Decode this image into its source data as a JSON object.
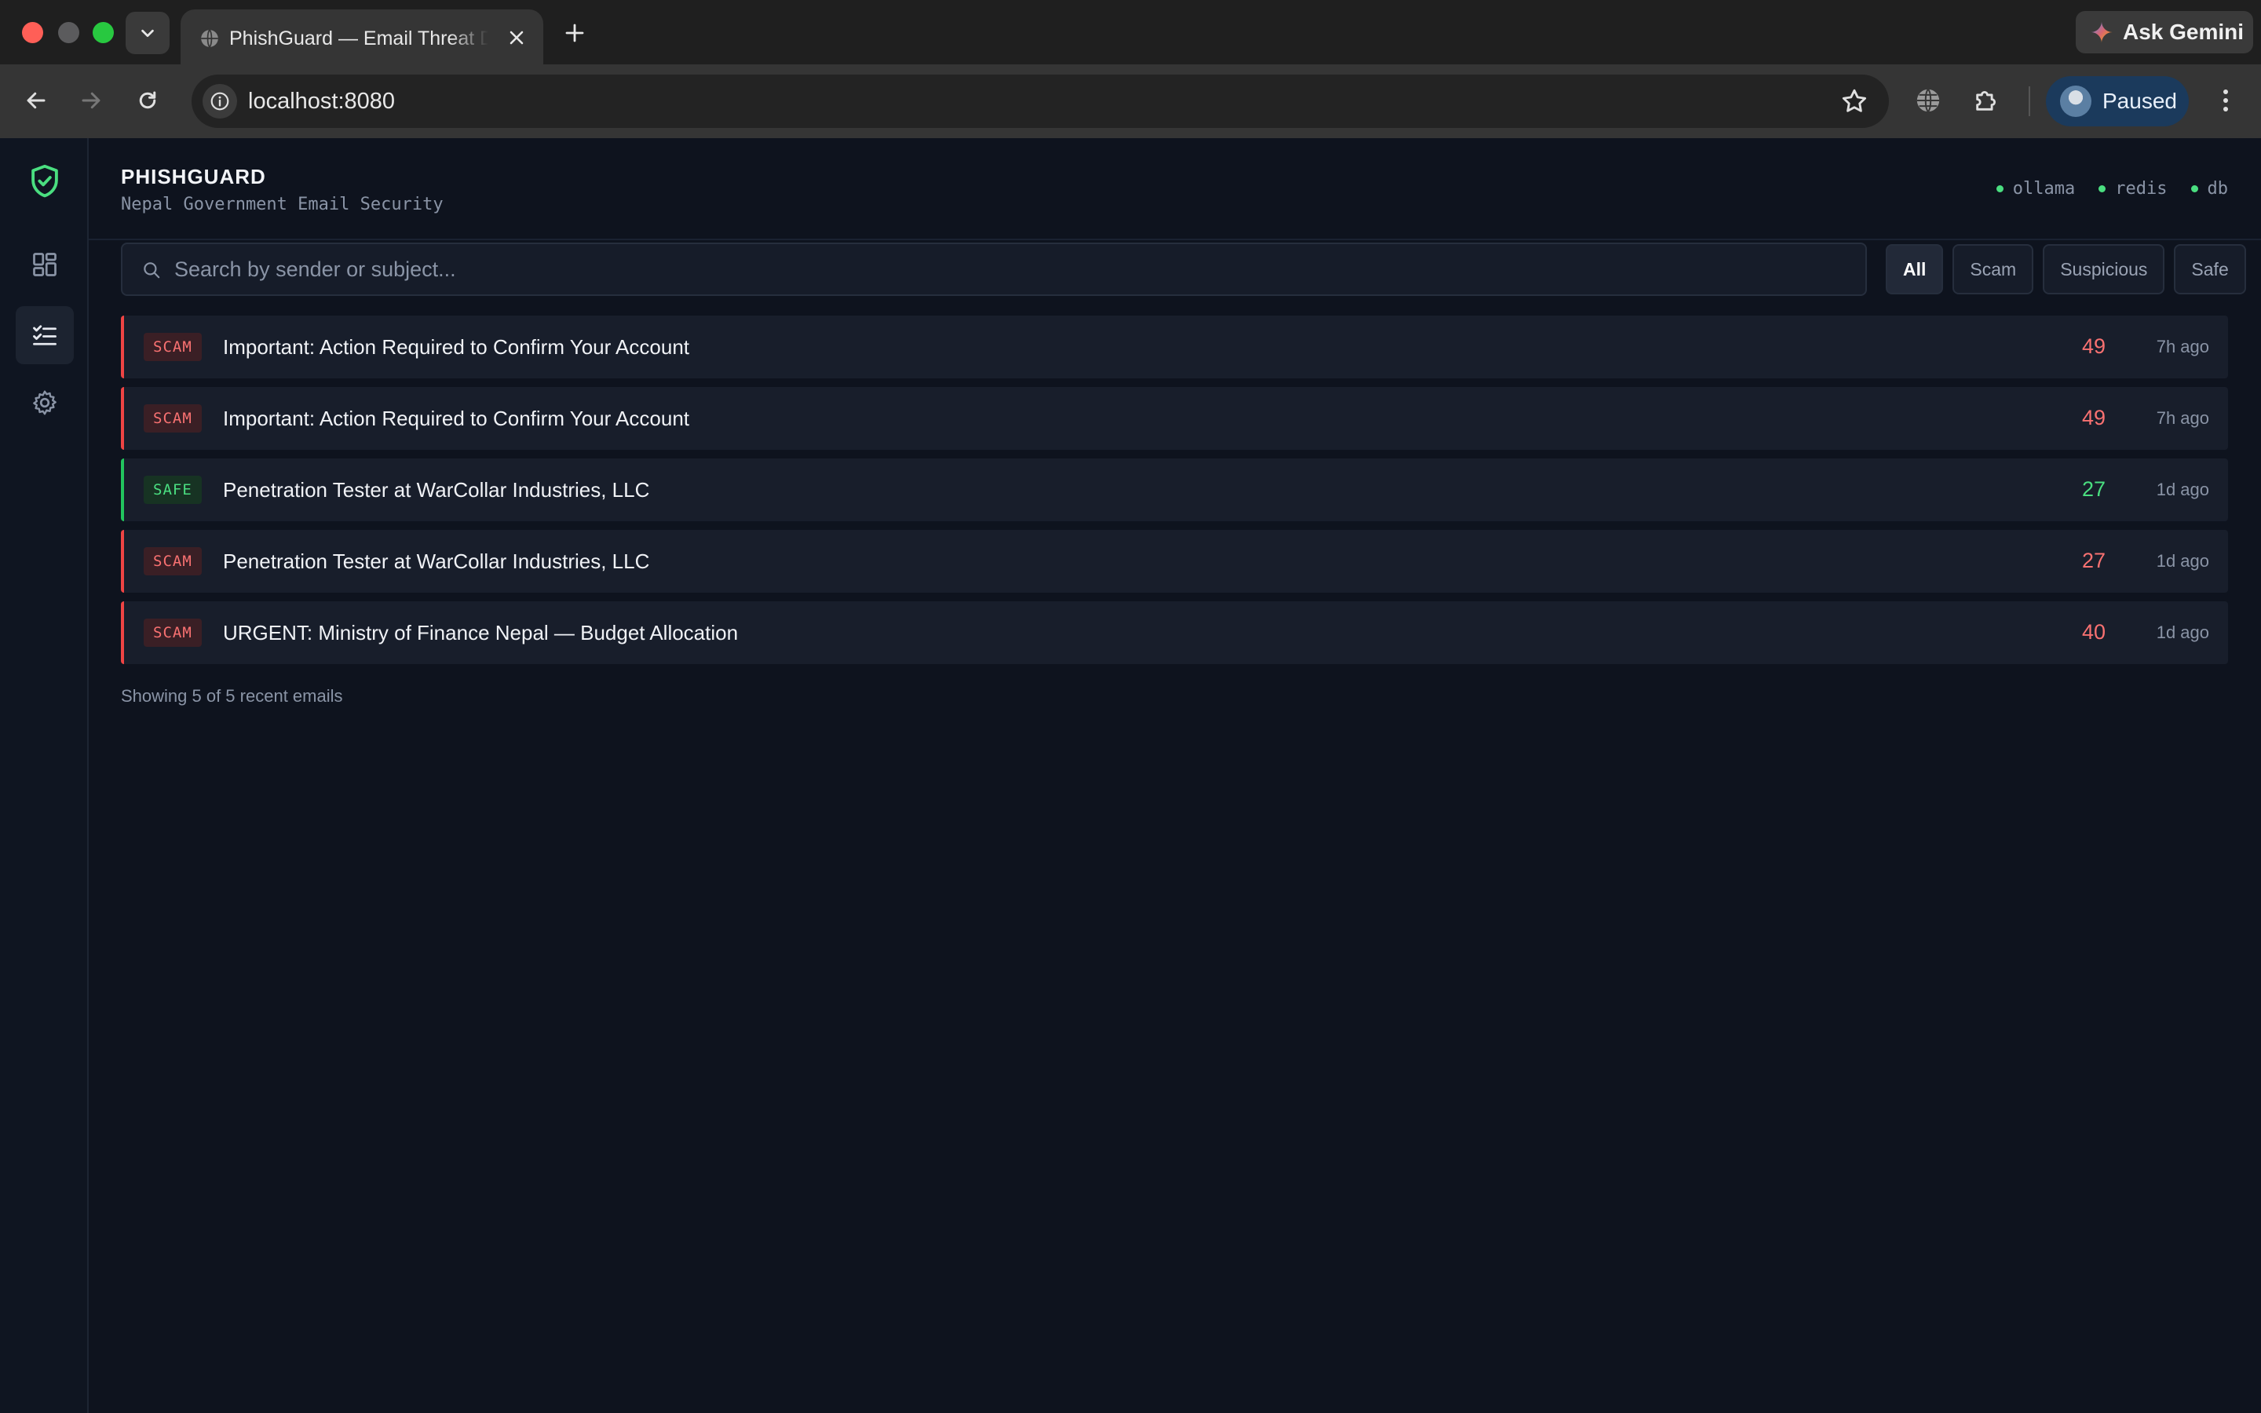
{
  "browser": {
    "tab_title": "PhishGuard — Email Threat Dashboard",
    "url": "localhost:8080",
    "gemini_label": "Ask Gemini",
    "profile_status": "Paused"
  },
  "app": {
    "brand": "PHISHGUARD",
    "subtitle": "Nepal Government Email Security",
    "services": [
      {
        "name": "ollama",
        "status_color": "#4ade80"
      },
      {
        "name": "redis",
        "status_color": "#4ade80"
      },
      {
        "name": "db",
        "status_color": "#4ade80"
      }
    ],
    "nav": [
      {
        "name": "dashboard",
        "icon": "grid-icon",
        "active": false
      },
      {
        "name": "email-list",
        "icon": "checklist-icon",
        "active": true
      },
      {
        "name": "settings",
        "icon": "gear-icon",
        "active": false
      }
    ]
  },
  "search": {
    "placeholder": "Search by sender or subject...",
    "value": ""
  },
  "filters": [
    {
      "label": "All",
      "active": true
    },
    {
      "label": "Scam",
      "active": false
    },
    {
      "label": "Suspicious",
      "active": false
    },
    {
      "label": "Safe",
      "active": false
    }
  ],
  "emails": [
    {
      "verdict": "SCAM",
      "subject": "Important: Action Required to Confirm Your Account",
      "score": "49",
      "age": "7h ago"
    },
    {
      "verdict": "SCAM",
      "subject": "Important: Action Required to Confirm Your Account",
      "score": "49",
      "age": "7h ago"
    },
    {
      "verdict": "SAFE",
      "subject": "Penetration Tester at WarCollar Industries, LLC",
      "score": "27",
      "age": "1d ago"
    },
    {
      "verdict": "SCAM",
      "subject": "Penetration Tester at WarCollar Industries, LLC",
      "score": "27",
      "age": "1d ago"
    },
    {
      "verdict": "SCAM",
      "subject": "URGENT: Ministry of Finance Nepal — Budget Allocation",
      "score": "40",
      "age": "1d ago"
    }
  ],
  "footer_note": "Showing 5 of 5 recent emails",
  "colors": {
    "scam": "#f87171",
    "safe": "#4ade80",
    "accent": "#4ade80"
  }
}
